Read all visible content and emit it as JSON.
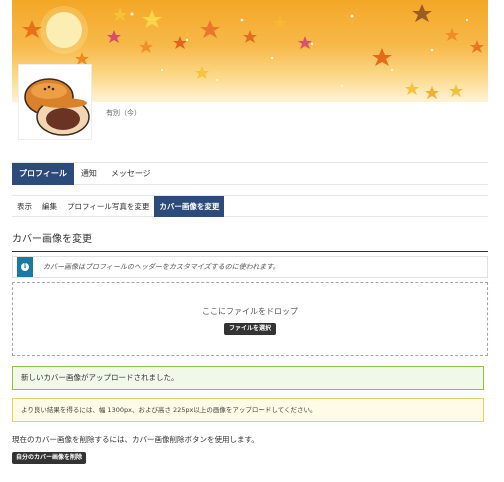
{
  "profile": {
    "member_name": "有別（今）"
  },
  "nav_primary": {
    "tabs": [
      {
        "label": "プロフィール",
        "active": true
      },
      {
        "label": "通知",
        "active": false
      },
      {
        "label": "メッセージ",
        "active": false
      }
    ]
  },
  "nav_secondary": {
    "tabs": [
      {
        "label": "表示",
        "active": false
      },
      {
        "label": "編集",
        "active": false
      },
      {
        "label": "プロフィール写真を変更",
        "active": false
      },
      {
        "label": "カバー画像を変更",
        "active": true
      }
    ]
  },
  "page": {
    "title": "カバー画像を変更"
  },
  "info": {
    "icon": "info-icon",
    "text": "カバー画像はプロフィールのヘッダーをカスタマイズするのに使われます。"
  },
  "dropzone": {
    "label": "ここにファイルをドロップ",
    "button": "ファイルを選択"
  },
  "messages": {
    "success": "新しいカバー画像がアップロードされました。",
    "warning": "より良い結果を得るには、幅 1300px、および高さ 225px以上の画像をアップロードしてください。"
  },
  "delete": {
    "note": "現在のカバー画像を削除するには、カバー画像削除ボタンを使用します。",
    "button": "自分のカバー画像を削除"
  },
  "colors": {
    "nav_active": "#2c4b7a",
    "info_icon_bg": "#1a7aa0",
    "success_border": "#8bc34a",
    "warning_border": "#e6d06a",
    "cover_orange": "#f4a726"
  }
}
